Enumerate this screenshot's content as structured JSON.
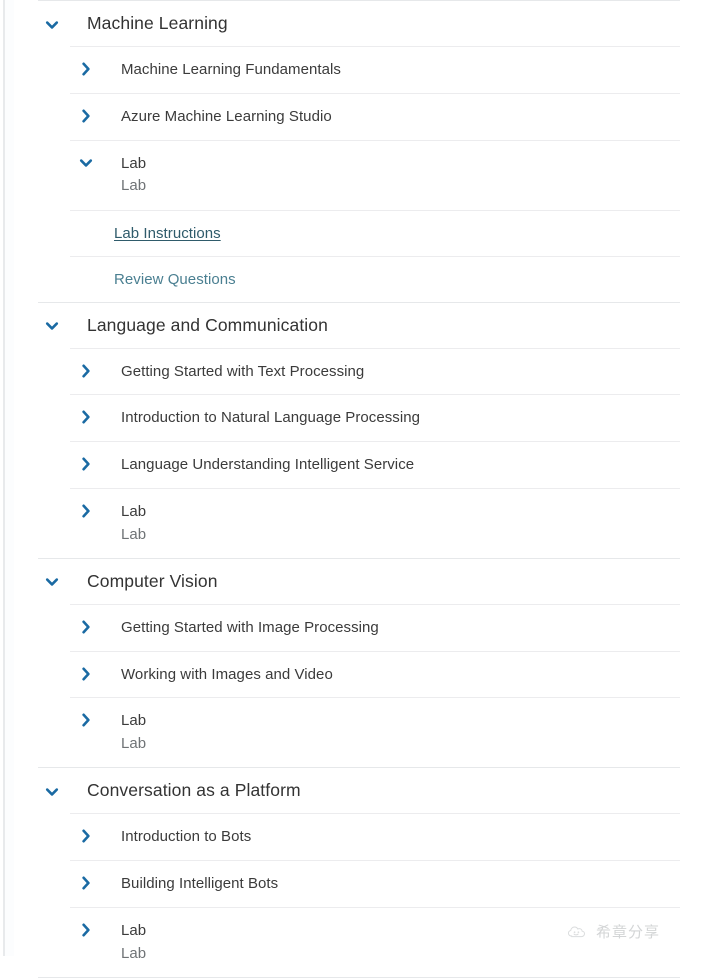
{
  "outline": {
    "sections": [
      {
        "title": "Machine Learning",
        "chevron": "chevron-down-icon",
        "items": [
          {
            "kind": "item",
            "title": "Machine Learning Fundamentals",
            "sub": "",
            "chevron": "chevron-right-icon"
          },
          {
            "kind": "item",
            "title": "Azure Machine Learning Studio",
            "sub": "",
            "chevron": "chevron-right-icon"
          },
          {
            "kind": "item",
            "title": "Lab",
            "sub": "Lab",
            "chevron": "chevron-down-icon"
          },
          {
            "kind": "link",
            "title": "Lab Instructions",
            "style": "underlined"
          },
          {
            "kind": "link",
            "title": "Review Questions",
            "style": "plain"
          }
        ]
      },
      {
        "title": "Language and Communication",
        "chevron": "chevron-down-icon",
        "items": [
          {
            "kind": "item",
            "title": "Getting Started with Text Processing",
            "sub": "",
            "chevron": "chevron-right-icon"
          },
          {
            "kind": "item",
            "title": "Introduction to Natural Language Processing",
            "sub": "",
            "chevron": "chevron-right-icon"
          },
          {
            "kind": "item",
            "title": "Language Understanding Intelligent Service",
            "sub": "",
            "chevron": "chevron-right-icon"
          },
          {
            "kind": "item",
            "title": "Lab",
            "sub": "Lab",
            "chevron": "chevron-right-icon"
          }
        ]
      },
      {
        "title": "Computer Vision",
        "chevron": "chevron-down-icon",
        "items": [
          {
            "kind": "item",
            "title": "Getting Started with Image Processing",
            "sub": "",
            "chevron": "chevron-right-icon"
          },
          {
            "kind": "item",
            "title": "Working with Images and Video",
            "sub": "",
            "chevron": "chevron-right-icon"
          },
          {
            "kind": "item",
            "title": "Lab",
            "sub": "Lab",
            "chevron": "chevron-right-icon"
          }
        ]
      },
      {
        "title": "Conversation as a Platform",
        "chevron": "chevron-down-icon",
        "items": [
          {
            "kind": "item",
            "title": "Introduction to Bots",
            "sub": "",
            "chevron": "chevron-right-icon"
          },
          {
            "kind": "item",
            "title": "Building Intelligent Bots",
            "sub": "",
            "chevron": "chevron-right-icon"
          },
          {
            "kind": "item",
            "title": "Lab",
            "sub": "Lab",
            "chevron": "chevron-right-icon"
          }
        ]
      }
    ]
  },
  "watermark": {
    "text": "希章分享",
    "icon": "cloud-face-icon"
  },
  "colors": {
    "chevron": "#1a6aa3",
    "section_title": "#333333",
    "item_title": "#3b3b3b",
    "item_sub": "#6f7376",
    "link": "#37636f",
    "divider": "#e6e8ea",
    "background": "#ffffff"
  }
}
